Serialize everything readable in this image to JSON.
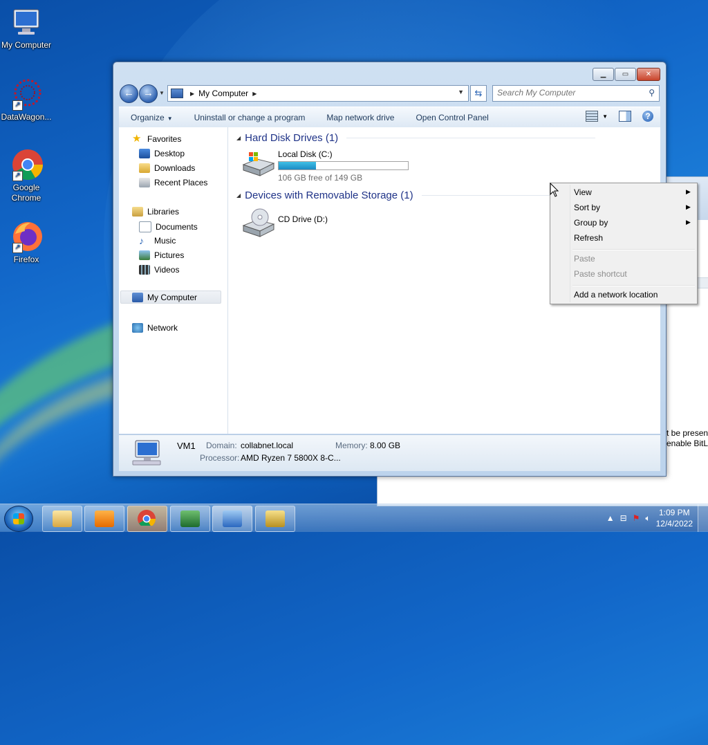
{
  "desktop": {
    "icons": [
      {
        "label": "My Computer"
      },
      {
        "label": "DataWagon..."
      },
      {
        "label": "Google Chrome"
      },
      {
        "label": "Firefox"
      }
    ],
    "background_window_text": [
      "t be present",
      "enable BitL"
    ]
  },
  "explorer": {
    "address": {
      "crumb": "My Computer"
    },
    "search": {
      "placeholder": "Search My Computer"
    },
    "toolbar": {
      "organize": "Organize",
      "uninstall": "Uninstall or change a program",
      "map_drive": "Map network drive",
      "control_panel": "Open Control Panel"
    },
    "nav": {
      "favorites": "Favorites",
      "desktop": "Desktop",
      "downloads": "Downloads",
      "recent": "Recent Places",
      "libraries": "Libraries",
      "documents": "Documents",
      "music": "Music",
      "pictures": "Pictures",
      "videos": "Videos",
      "computer": "My Computer",
      "network": "Network"
    },
    "groups": {
      "hdd": "Hard Disk Drives (1)",
      "removable": "Devices with Removable Storage (1)"
    },
    "drives": {
      "c": {
        "name": "Local Disk (C:)",
        "free": "106 GB free of 149 GB",
        "used_fraction": 0.29
      },
      "d": {
        "name": "CD Drive (D:)"
      }
    },
    "details": {
      "name": "VM1",
      "domain_label": "Domain:",
      "domain": "collabnet.local",
      "memory_label": "Memory:",
      "memory": "8.00 GB",
      "processor_label": "Processor:",
      "processor": "AMD Ryzen 7 5800X 8-C..."
    }
  },
  "context_menu": {
    "view": "View",
    "sort_by": "Sort by",
    "group_by": "Group by",
    "refresh": "Refresh",
    "paste": "Paste",
    "paste_shortcut": "Paste shortcut",
    "add_network_location": "Add a network location"
  },
  "taskbar": {
    "clock": {
      "time": "1:09 PM",
      "date": "12/4/2022"
    }
  },
  "colors": {
    "group_heading": "#1e3287",
    "toolbar_text": "#1e395b",
    "drive_bar": "#1b8bc4"
  }
}
